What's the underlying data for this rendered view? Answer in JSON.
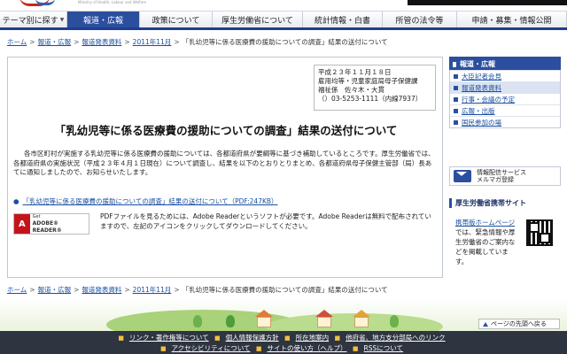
{
  "header": {
    "ministry_en": "Ministry of Health, Labour and Welfare"
  },
  "gnav": [
    {
      "label": "テーマ別に探す",
      "active": false
    },
    {
      "label": "報道・広報",
      "active": true
    },
    {
      "label": "政策について",
      "active": false
    },
    {
      "label": "厚生労働省について",
      "active": false
    },
    {
      "label": "統計情報・白書",
      "active": false
    },
    {
      "label": "所管の法令等",
      "active": false
    },
    {
      "label": "申請・募集・情報公開",
      "active": false
    }
  ],
  "breadcrumb": {
    "items": [
      "ホーム",
      "報道・広報",
      "報道発表資料",
      "2011年11月"
    ],
    "current": "「乳幼児等に係る医療費の援助についての調査」結果の送付について",
    "separator": ">"
  },
  "memo": {
    "date": "平成２３年１１月１８日",
    "dept": "雇用均等・児童家庭局母子保健課",
    "person": "福祉係　佐々木・大貫",
    "phone": "（）03-5253-1111（内線7937）"
  },
  "main": {
    "title": "「乳幼児等に係る医療費の援助についての調査」結果の送付について",
    "body": "各市区町村が実施する乳幼児等に係る医療費の援助については、各都道府県が要綱等に基づき補助しているところです。厚生労働省では、各都道府県の実施状況（平成２３年４月１日現在）について調査し、結果を以下のとおりとりまとめ、各都道府県母子保健主管部（局）長あてに通知しましたので、お知らせいたします。",
    "pdf_link": "「乳幼児等に係る医療費の援助についての調査」結果の送付について（PDF:247KB）",
    "adobe_get": "Get",
    "adobe_reader": "ADOBE® READER®",
    "adobe_note": "PDFファイルを見るためには、Adobe Readerというソフトが必要です。Adobe Readerは無料で配布されていますので、左記のアイコンをクリックしてダウンロードしてください。"
  },
  "sidebar": {
    "heading": "報道・広報",
    "items": [
      {
        "label": "大臣記者会見",
        "selected": false
      },
      {
        "label": "報道発表資料",
        "selected": true
      },
      {
        "label": "行事・会議の予定",
        "selected": false
      },
      {
        "label": "広報・出版",
        "selected": false
      },
      {
        "label": "国民参加の場",
        "selected": false
      }
    ],
    "mail_line1": "情報配信サービス",
    "mail_line2": "メルマガ登録",
    "mobile_heading": "厚生労働省携帯サイト",
    "mobile_link": "携帯版ホームページ",
    "mobile_text": "では、緊急情報や厚生労働省のご案内などを掲載しています。"
  },
  "pagetop": "ページの先頭へ戻る",
  "footer": {
    "row1": [
      "リンク・著作権等について",
      "個人情報保護方針",
      "所在地案内",
      "他府省、地方支分部局へのリンク"
    ],
    "row2": [
      "アクセシビリティについて",
      "サイトの使い方（ヘルプ）",
      "RSSについて"
    ]
  }
}
